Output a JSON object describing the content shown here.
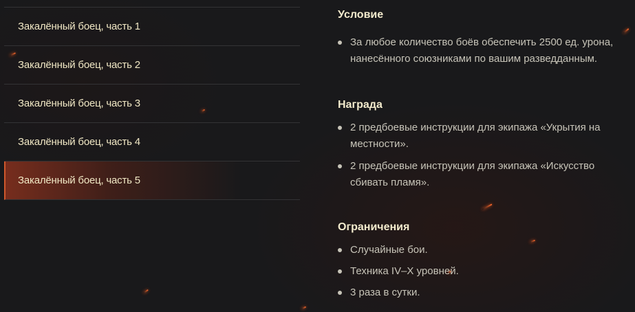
{
  "quests": [
    {
      "label": "Закалённый боец, часть 1",
      "active": false
    },
    {
      "label": "Закалённый боец, часть 2",
      "active": false
    },
    {
      "label": "Закалённый боец, часть 3",
      "active": false
    },
    {
      "label": "Закалённый боец, часть 4",
      "active": false
    },
    {
      "label": "Закалённый боец, часть 5",
      "active": true
    }
  ],
  "condition": {
    "title": "Условие",
    "items": [
      "За любое количество боёв обеспечить 2500 ед. урона, нанесённого союзниками по вашим разведданным."
    ]
  },
  "reward": {
    "title": "Награда",
    "items": [
      "2 предбоевые инструкции для экипажа «Укрытия на местности».",
      "2 предбоевые инструкции для экипажа «Искусство сбивать пламя»."
    ]
  },
  "restrictions": {
    "title": "Ограничения",
    "items": [
      "Случайные бои.",
      "Техника IV–X уровней.",
      "3 раза в сутки."
    ]
  },
  "colors": {
    "background": "#19191b",
    "accent": "#d0582c",
    "title_text": "#f3ebcd",
    "body_text": "#c7c4b8"
  }
}
